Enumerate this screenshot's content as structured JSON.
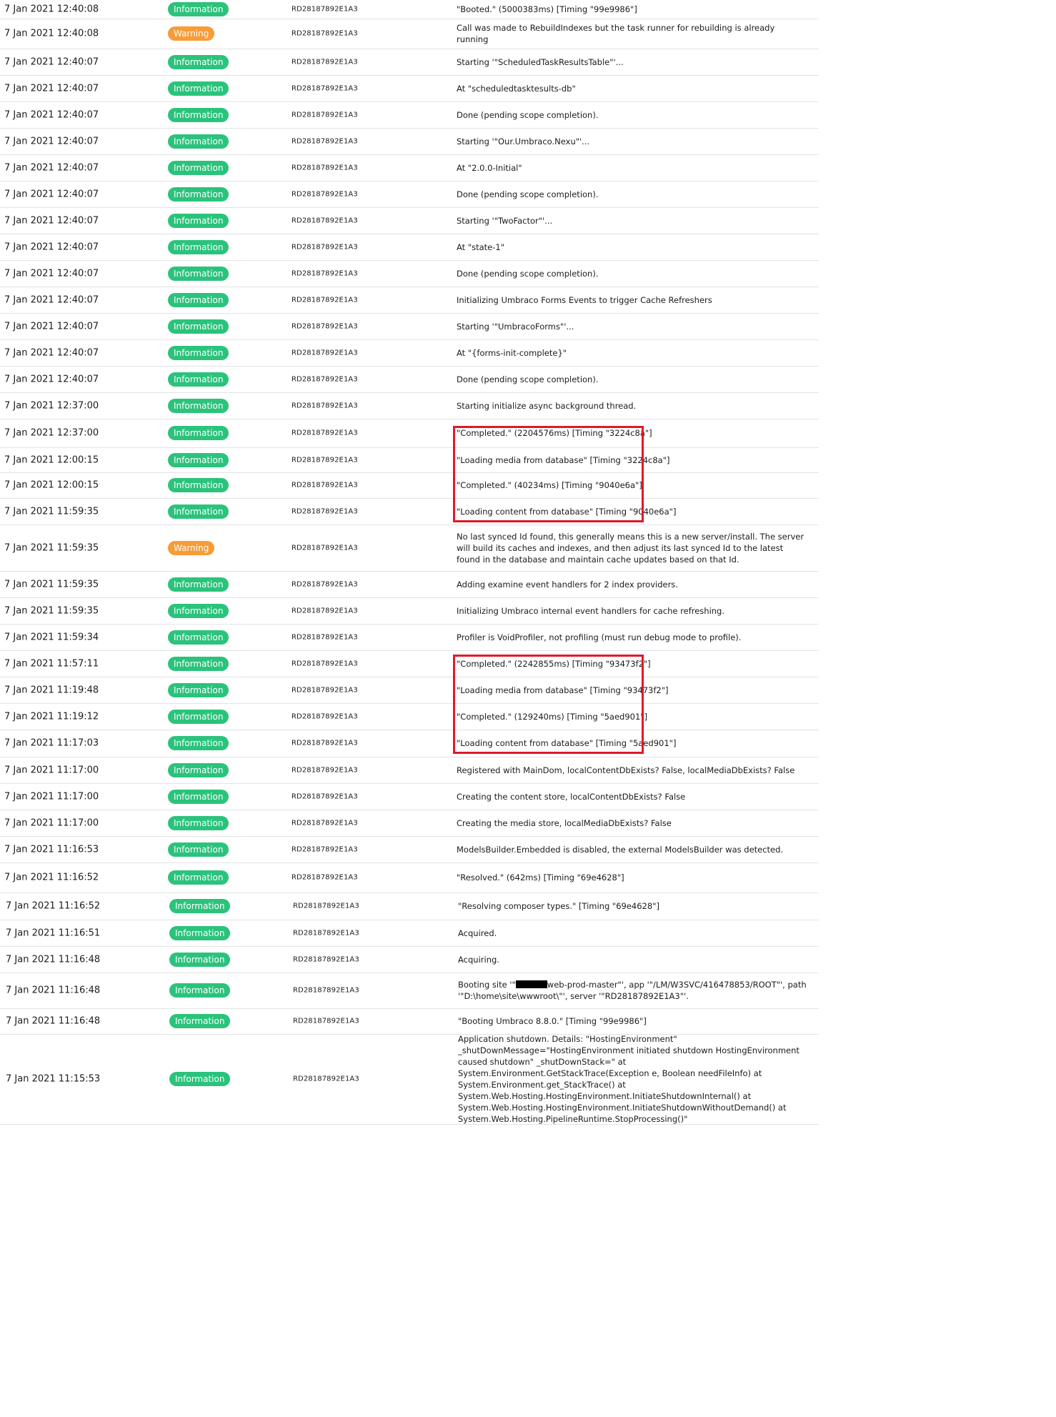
{
  "rows": [
    {
      "ts": "7 Jan 2021 12:40:08",
      "level": "Information",
      "machine": "RD28187892E1A3",
      "msg": "\"Booted.\" (5000383ms) [Timing \"99e9986\"]"
    },
    {
      "ts": "7 Jan 2021 12:40:08",
      "level": "Warning",
      "machine": "RD28187892E1A3",
      "msg": "Call was made to RebuildIndexes but the task runner for rebuilding is already running"
    },
    {
      "ts": "7 Jan 2021 12:40:07",
      "level": "Information",
      "machine": "RD28187892E1A3",
      "msg": "Starting '\"ScheduledTaskResultsTable\"'..."
    },
    {
      "ts": "7 Jan 2021 12:40:07",
      "level": "Information",
      "machine": "RD28187892E1A3",
      "msg": "At \"scheduledtasktesults-db\""
    },
    {
      "ts": "7 Jan 2021 12:40:07",
      "level": "Information",
      "machine": "RD28187892E1A3",
      "msg": "Done (pending scope completion)."
    },
    {
      "ts": "7 Jan 2021 12:40:07",
      "level": "Information",
      "machine": "RD28187892E1A3",
      "msg": "Starting '\"Our.Umbraco.Nexu\"'..."
    },
    {
      "ts": "7 Jan 2021 12:40:07",
      "level": "Information",
      "machine": "RD28187892E1A3",
      "msg": "At \"2.0.0-Initial\""
    },
    {
      "ts": "7 Jan 2021 12:40:07",
      "level": "Information",
      "machine": "RD28187892E1A3",
      "msg": "Done (pending scope completion)."
    },
    {
      "ts": "7 Jan 2021 12:40:07",
      "level": "Information",
      "machine": "RD28187892E1A3",
      "msg": "Starting '\"TwoFactor\"'..."
    },
    {
      "ts": "7 Jan 2021 12:40:07",
      "level": "Information",
      "machine": "RD28187892E1A3",
      "msg": "At \"state-1\""
    },
    {
      "ts": "7 Jan 2021 12:40:07",
      "level": "Information",
      "machine": "RD28187892E1A3",
      "msg": "Done (pending scope completion)."
    },
    {
      "ts": "7 Jan 2021 12:40:07",
      "level": "Information",
      "machine": "RD28187892E1A3",
      "msg": "Initializing Umbraco Forms Events to trigger Cache Refreshers"
    },
    {
      "ts": "7 Jan 2021 12:40:07",
      "level": "Information",
      "machine": "RD28187892E1A3",
      "msg": "Starting '\"UmbracoForms\"'..."
    },
    {
      "ts": "7 Jan 2021 12:40:07",
      "level": "Information",
      "machine": "RD28187892E1A3",
      "msg": "At \"{forms-init-complete}\""
    },
    {
      "ts": "7 Jan 2021 12:40:07",
      "level": "Information",
      "machine": "RD28187892E1A3",
      "msg": "Done (pending scope completion)."
    },
    {
      "ts": "7 Jan 2021 12:37:00",
      "level": "Information",
      "machine": "RD28187892E1A3",
      "msg": "Starting initialize async background thread."
    },
    {
      "ts": "7 Jan 2021 12:37:00",
      "level": "Information",
      "machine": "RD28187892E1A3",
      "msg": "\"Completed.\" (2204576ms) [Timing \"3224c8a\"]"
    },
    {
      "ts": "7 Jan 2021 12:00:15",
      "level": "Information",
      "machine": "RD28187892E1A3",
      "msg": "\"Loading media from database\" [Timing \"3224c8a\"]"
    },
    {
      "ts": "7 Jan 2021 12:00:15",
      "level": "Information",
      "machine": "RD28187892E1A3",
      "msg": "\"Completed.\" (40234ms) [Timing \"9040e6a\"]"
    },
    {
      "ts": "7 Jan 2021 11:59:35",
      "level": "Information",
      "machine": "RD28187892E1A3",
      "msg": "\"Loading content from database\" [Timing \"9040e6a\"]"
    },
    {
      "ts": "7 Jan 2021 11:59:35",
      "level": "Warning",
      "machine": "RD28187892E1A3",
      "msg": "No last synced Id found, this generally means this is a new server/install. The server will build its caches and indexes, and then adjust its last synced Id to the latest found in the database and maintain cache updates based on that Id."
    },
    {
      "ts": "7 Jan 2021 11:59:35",
      "level": "Information",
      "machine": "RD28187892E1A3",
      "msg": "Adding examine event handlers for 2 index providers."
    },
    {
      "ts": "7 Jan 2021 11:59:35",
      "level": "Information",
      "machine": "RD28187892E1A3",
      "msg": "Initializing Umbraco internal event handlers for cache refreshing."
    },
    {
      "ts": "7 Jan 2021 11:59:34",
      "level": "Information",
      "machine": "RD28187892E1A3",
      "msg": "Profiler is VoidProfiler, not profiling (must run debug mode to profile)."
    },
    {
      "ts": "7 Jan 2021 11:57:11",
      "level": "Information",
      "machine": "RD28187892E1A3",
      "msg": "\"Completed.\" (2242855ms) [Timing \"93473f2\"]"
    },
    {
      "ts": "7 Jan 2021 11:19:48",
      "level": "Information",
      "machine": "RD28187892E1A3",
      "msg": "\"Loading media from database\" [Timing \"93473f2\"]"
    },
    {
      "ts": "7 Jan 2021 11:19:12",
      "level": "Information",
      "machine": "RD28187892E1A3",
      "msg": "\"Completed.\" (129240ms) [Timing \"5aed901\"]"
    },
    {
      "ts": "7 Jan 2021 11:17:03",
      "level": "Information",
      "machine": "RD28187892E1A3",
      "msg": "\"Loading content from database\" [Timing \"5aed901\"]"
    },
    {
      "ts": "7 Jan 2021 11:17:00",
      "level": "Information",
      "machine": "RD28187892E1A3",
      "msg": "Registered with MainDom, localContentDbExists? False, localMediaDbExists? False"
    },
    {
      "ts": "7 Jan 2021 11:17:00",
      "level": "Information",
      "machine": "RD28187892E1A3",
      "msg": "Creating the content store, localContentDbExists? False"
    },
    {
      "ts": "7 Jan 2021 11:17:00",
      "level": "Information",
      "machine": "RD28187892E1A3",
      "msg": "Creating the media store, localMediaDbExists? False"
    },
    {
      "ts": "7 Jan 2021 11:16:53",
      "level": "Information",
      "machine": "RD28187892E1A3",
      "msg": "ModelsBuilder.Embedded is disabled, the external ModelsBuilder was detected."
    },
    {
      "ts": "7 Jan 2021 11:16:52",
      "level": "Information",
      "machine": "RD28187892E1A3",
      "msg": "\"Resolved.\" (642ms) [Timing \"69e4628\"]"
    },
    {
      "ts": "7 Jan 2021 11:16:52",
      "level": "Information",
      "machine": "RD28187892E1A3",
      "msg": "\"Resolving composer types.\" [Timing \"69e4628\"]"
    },
    {
      "ts": "7 Jan 2021 11:16:51",
      "level": "Information",
      "machine": "RD28187892E1A3",
      "msg": "Acquired."
    },
    {
      "ts": "7 Jan 2021 11:16:48",
      "level": "Information",
      "machine": "RD28187892E1A3",
      "msg": "Acquiring."
    },
    {
      "ts": "7 Jan 2021 11:16:48",
      "level": "Information",
      "machine": "RD28187892E1A3",
      "msg_before_redaction": "Booting site '\"",
      "msg": "web-prod-master\"', app '\"/LM/W3SVC/416478853/ROOT\"', path '\"D:\\home\\site\\wwwroot\\\"', server '\"RD28187892E1A3\"'."
    },
    {
      "ts": "7 Jan 2021 11:16:48",
      "level": "Information",
      "machine": "RD28187892E1A3",
      "msg": "\"Booting Umbraco 8.8.0.\" [Timing \"99e9986\"]"
    },
    {
      "ts": "7 Jan 2021 11:15:53",
      "level": "Information",
      "machine": "RD28187892E1A3",
      "msg": "Application shutdown. Details: \"HostingEnvironment\" _shutDownMessage=\"HostingEnvironment initiated shutdown HostingEnvironment caused shutdown\" _shutDownStack=\" at System.Environment.GetStackTrace(Exception e, Boolean needFileInfo) at System.Environment.get_StackTrace() at System.Web.Hosting.HostingEnvironment.InitiateShutdownInternal() at System.Web.Hosting.HostingEnvironment.InitiateShutdownWithoutDemand() at System.Web.Hosting.PipelineRuntime.StopProcessing()\""
    }
  ],
  "colors": {
    "information": "#2bc37c",
    "warning": "#f79c37",
    "highlight": "#e0192a",
    "divider": "#e3e3e3"
  }
}
